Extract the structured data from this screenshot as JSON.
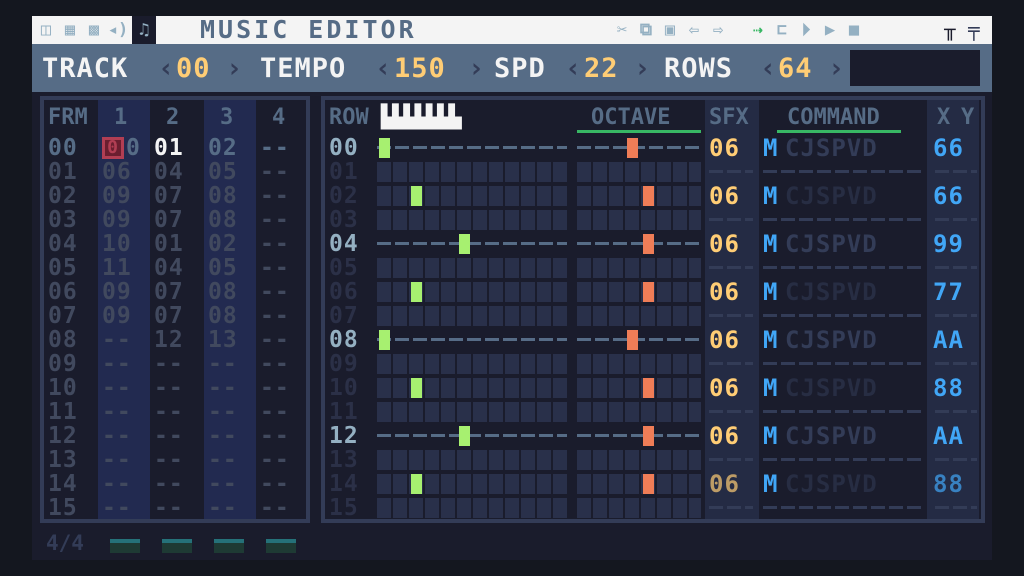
{
  "title": "MUSIC EDITOR",
  "topbar": {
    "left_icons": [
      "code-icon",
      "sprite-icon",
      "map-icon",
      "sfx-icon"
    ],
    "music_icon": "♫",
    "right_icons": [
      "cut-icon",
      "copy-icon",
      "paste-icon",
      "undo-icon",
      "redo-icon",
      "follow-icon",
      "loop-icon",
      "play-icon",
      "play-row-icon",
      "stop-icon"
    ],
    "view_icons": [
      "pattern-view-icon",
      "piano-view-icon"
    ]
  },
  "header": {
    "track_label": "TRACK",
    "track_value": "00",
    "tempo_label": "TEMPO",
    "tempo_value": "150",
    "spd_label": "SPD",
    "spd_value": "22",
    "rows_label": "ROWS",
    "rows_value": "64"
  },
  "frames": {
    "headers": [
      "FRM",
      "1",
      "2",
      "3",
      "4"
    ],
    "rows": [
      {
        "frm": "00",
        "c1": "00",
        "c2": "01",
        "c3": "02",
        "c4": "--"
      },
      {
        "frm": "01",
        "c1": "06",
        "c2": "04",
        "c3": "05",
        "c4": "--"
      },
      {
        "frm": "02",
        "c1": "09",
        "c2": "07",
        "c3": "08",
        "c4": "--"
      },
      {
        "frm": "03",
        "c1": "09",
        "c2": "07",
        "c3": "08",
        "c4": "--"
      },
      {
        "frm": "04",
        "c1": "10",
        "c2": "01",
        "c3": "02",
        "c4": "--"
      },
      {
        "frm": "05",
        "c1": "11",
        "c2": "04",
        "c3": "05",
        "c4": "--"
      },
      {
        "frm": "06",
        "c1": "09",
        "c2": "07",
        "c3": "08",
        "c4": "--"
      },
      {
        "frm": "07",
        "c1": "09",
        "c2": "07",
        "c3": "08",
        "c4": "--"
      },
      {
        "frm": "08",
        "c1": "--",
        "c2": "12",
        "c3": "13",
        "c4": "--"
      },
      {
        "frm": "09",
        "c1": "--",
        "c2": "--",
        "c3": "--",
        "c4": "--"
      },
      {
        "frm": "10",
        "c1": "--",
        "c2": "--",
        "c3": "--",
        "c4": "--"
      },
      {
        "frm": "11",
        "c1": "--",
        "c2": "--",
        "c3": "--",
        "c4": "--"
      },
      {
        "frm": "12",
        "c1": "--",
        "c2": "--",
        "c3": "--",
        "c4": "--"
      },
      {
        "frm": "13",
        "c1": "--",
        "c2": "--",
        "c3": "--",
        "c4": "--"
      },
      {
        "frm": "14",
        "c1": "--",
        "c2": "--",
        "c3": "--",
        "c4": "--"
      },
      {
        "frm": "15",
        "c1": "--",
        "c2": "--",
        "c3": "--",
        "c4": "--"
      }
    ]
  },
  "pattern": {
    "headers": {
      "row": "ROW",
      "octave": "OCTAVE",
      "sfx": "SFX",
      "command": "COMMAND",
      "x": "X",
      "y": "Y"
    },
    "row_numbers": [
      "00",
      "01",
      "02",
      "03",
      "04",
      "05",
      "06",
      "07",
      "08",
      "09",
      "10",
      "11",
      "12",
      "13",
      "14",
      "15"
    ],
    "notes": [
      {
        "row": 0,
        "note_col": 0,
        "octave_col": 3,
        "sfx": "06",
        "cmd": "M",
        "rest": "CJSPVD",
        "xy": "66"
      },
      {
        "row": 2,
        "note_col": 2,
        "octave_col": 4,
        "sfx": "06",
        "cmd": "M",
        "rest": "CJSPVD",
        "xy": "66"
      },
      {
        "row": 4,
        "note_col": 5,
        "octave_col": 4,
        "sfx": "06",
        "cmd": "M",
        "rest": "CJSPVD",
        "xy": "99"
      },
      {
        "row": 6,
        "note_col": 2,
        "octave_col": 4,
        "sfx": "06",
        "cmd": "M",
        "rest": "CJSPVD",
        "xy": "77"
      },
      {
        "row": 8,
        "note_col": 0,
        "octave_col": 3,
        "sfx": "06",
        "cmd": "M",
        "rest": "CJSPVD",
        "xy": "AA"
      },
      {
        "row": 10,
        "note_col": 2,
        "octave_col": 4,
        "sfx": "06",
        "cmd": "M",
        "rest": "CJSPVD",
        "xy": "88"
      },
      {
        "row": 12,
        "note_col": 5,
        "octave_col": 4,
        "sfx": "06",
        "cmd": "M",
        "rest": "CJSPVD",
        "xy": "AA"
      },
      {
        "row": 14,
        "note_col": 2,
        "octave_col": 4,
        "sfx": "06",
        "cmd": "M",
        "rest": "CJSPVD",
        "xy": "88"
      }
    ]
  },
  "bottom": {
    "signature": "4/4",
    "channels": 4
  },
  "colors": {
    "note": "#a7f070",
    "octave": "#ef7d57",
    "sfx": "#ffcd75",
    "command": "#41a6f6",
    "cursor": "#b13e53"
  }
}
